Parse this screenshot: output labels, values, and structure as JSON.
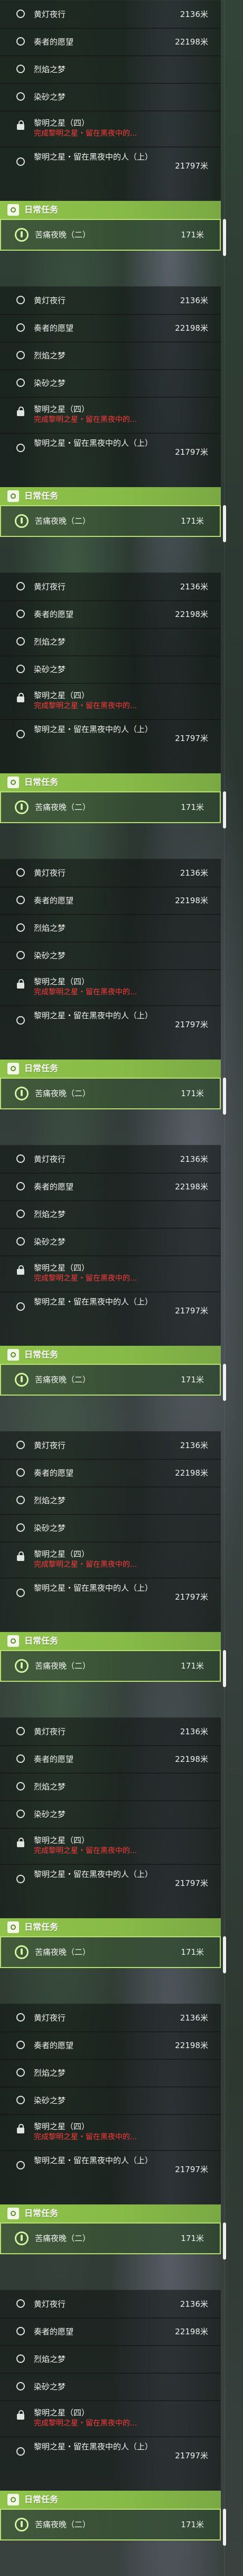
{
  "quests": [
    {
      "title": "黄灯夜行",
      "distance": "2136米",
      "icon": "circle-icon"
    },
    {
      "title": "奏者的愿望",
      "distance": "22198米",
      "icon": "circle-icon"
    },
    {
      "title": "烈焰之梦",
      "distance": "",
      "icon": "circle-icon"
    },
    {
      "title": "染砂之梦",
      "distance": "",
      "icon": "circle-icon"
    },
    {
      "title": "黎明之星（四）",
      "subtitle": "完成黎明之星・留在黑夜中的...",
      "distance": "",
      "icon": "lock-icon"
    },
    {
      "title": "黎明之星・留在黑夜中的人（上）",
      "distance": "21797米",
      "icon": "circle-icon"
    }
  ],
  "daily_header": "日常任务",
  "daily_task": {
    "title": "苦痛夜晚（二）",
    "distance": "171米"
  },
  "colors": {
    "header": "#8fc34a",
    "warning": "#ff3b3b",
    "text": "#eef2ef"
  }
}
